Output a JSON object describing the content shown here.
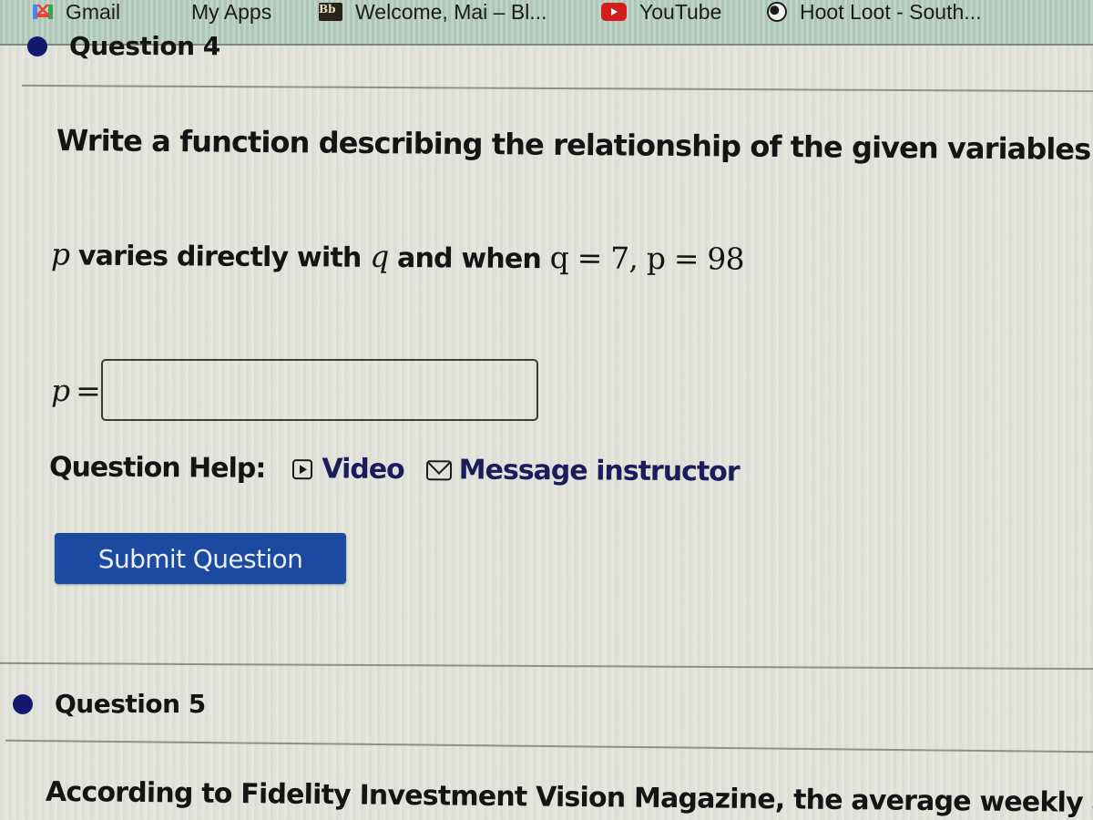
{
  "bookmarks": [
    {
      "label": "Gmail",
      "icon": "gmail-icon"
    },
    {
      "label": "My Apps",
      "icon": "my-apps-icon"
    },
    {
      "label": "Welcome, Mai – Bl...",
      "icon": "blackboard-icon",
      "icon_text": "Bb"
    },
    {
      "label": "YouTube",
      "icon": "youtube-icon"
    },
    {
      "label": "Hoot Loot - South...",
      "icon": "globe-icon"
    }
  ],
  "question4": {
    "title": "Question 4",
    "status_color": "#131a6e",
    "prompt": "Write a function describing the relationship of the given variables.",
    "problem": {
      "var_p": "p",
      "text1": " varies directly with ",
      "var_q": "q",
      "text2": " and when ",
      "cond1": "q = 7, ",
      "cond2": "p = 98"
    },
    "answer": {
      "label": "p",
      "equals": "=",
      "value": "",
      "placeholder": ""
    },
    "help": {
      "label": "Question Help:",
      "video_label": "Video",
      "message_label": "Message instructor"
    },
    "submit_label": "Submit Question",
    "submit_color": "#1b4aa0"
  },
  "question5": {
    "title": "Question 5",
    "status_color": "#131a6e",
    "text": "According to Fidelity Investment Vision Magazine, the average weekly al"
  }
}
